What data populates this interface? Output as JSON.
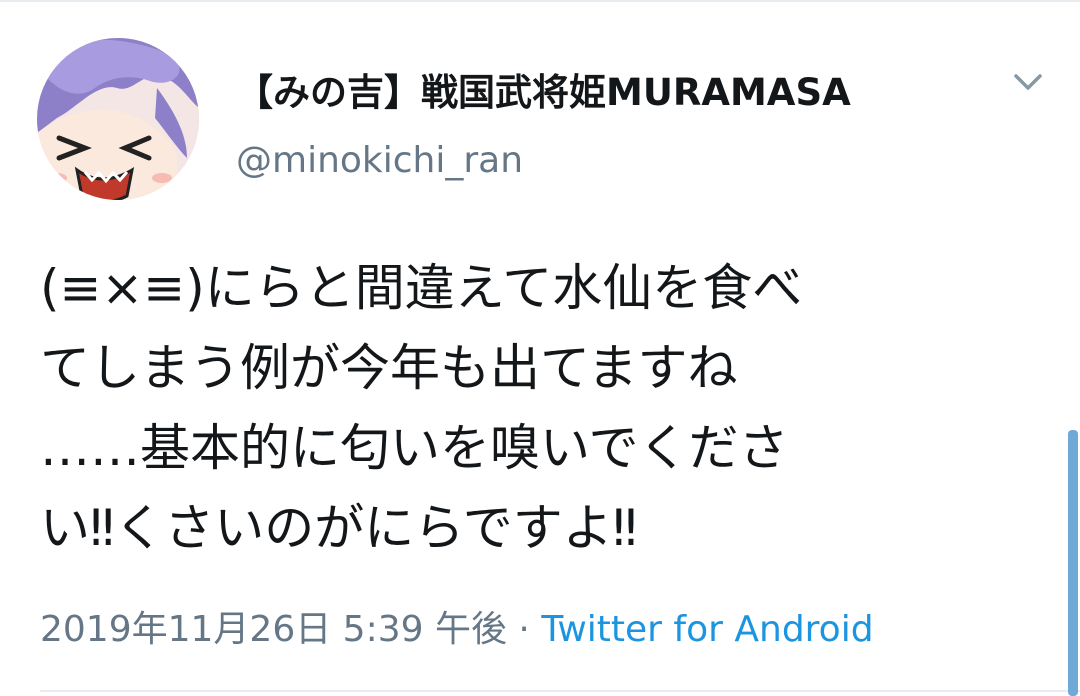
{
  "tweet": {
    "author": {
      "display_name": "【みの吉】戦国武将姫MURAMASA",
      "handle": "@minokichi_ran",
      "avatar_icon": "anime-character-avatar"
    },
    "text_lines": [
      "(≡×≡)にらと間違えて水仙を食べ",
      "てしまう例が今年も出てますね",
      "……基本的に匂いを嗅いでくださ",
      "い‼くさいのがにらですよ‼"
    ],
    "timestamp": "2019年11月26日 5:39 午後",
    "separator": "·",
    "source": "Twitter for Android",
    "menu_icon": "chevron-down-icon"
  },
  "colors": {
    "primary_text": "#14171a",
    "secondary_text": "#657786",
    "link": "#1b95e0",
    "divider": "#e6ecf0"
  }
}
